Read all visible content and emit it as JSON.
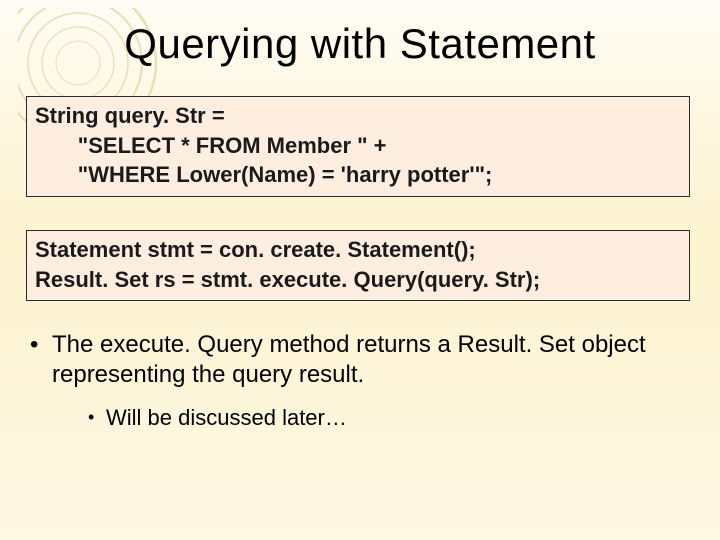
{
  "title": "Querying with Statement",
  "code_block_1": {
    "line1": "String query. Str =",
    "line2": "       \"SELECT * FROM Member \" +",
    "line3": "       \"WHERE Lower(Name) = 'harry potter'\";"
  },
  "code_block_2": {
    "line1": "Statement stmt = con. create. Statement();",
    "line2": "Result. Set rs = stmt. execute. Query(query. Str);"
  },
  "bullets": {
    "main": "The execute. Query method returns a Result. Set object representing the query result.",
    "sub": "Will be discussed later…"
  }
}
